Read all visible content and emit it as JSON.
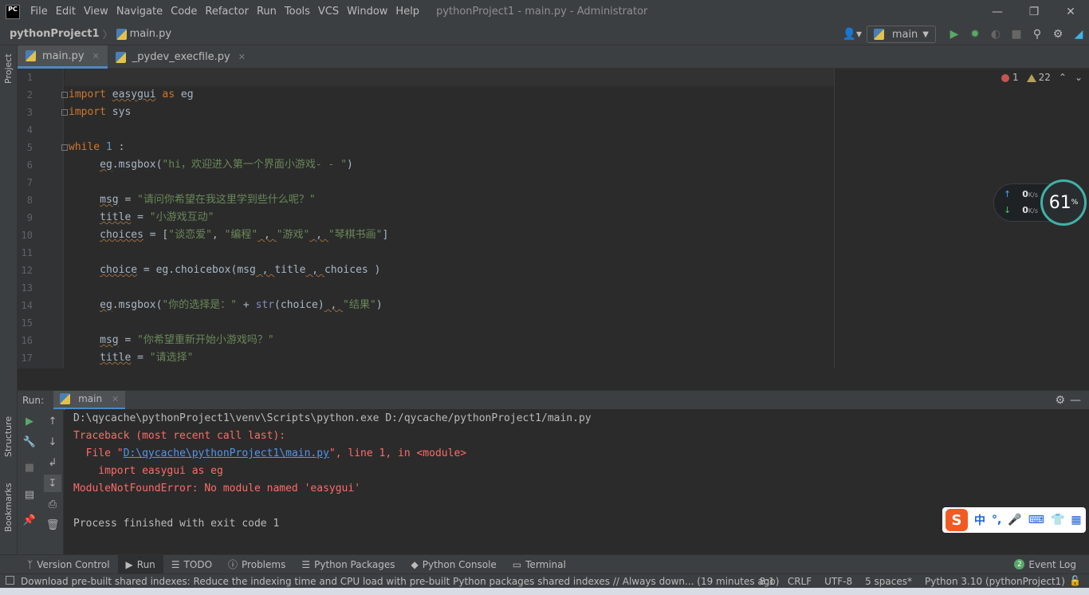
{
  "app": {
    "logo": "PC",
    "window_title": "pythonProject1 - main.py - Administrator",
    "menu": [
      "File",
      "Edit",
      "View",
      "Navigate",
      "Code",
      "Refactor",
      "Run",
      "Tools",
      "VCS",
      "Window",
      "Help"
    ]
  },
  "navbar": {
    "project": "pythonProject1",
    "file": "main.py",
    "run_config": "main"
  },
  "left_strip": {
    "project_label": "Project",
    "structure_label": "Structure",
    "bookmarks_label": "Bookmarks"
  },
  "editor_tabs": [
    {
      "label": "main.py"
    },
    {
      "label": "_pydev_execfile.py"
    }
  ],
  "inspections": {
    "errors": "1",
    "warnings": "22"
  },
  "line_numbers": [
    "1",
    "2",
    "3",
    "4",
    "5",
    "6",
    "7",
    "8",
    "9",
    "10",
    "11",
    "12",
    "13",
    "14",
    "15",
    "16",
    "17"
  ],
  "code": {
    "l2": {
      "kw1": "import",
      "mod": "easygui",
      "kw2": "as",
      "alias": "eg"
    },
    "l3": {
      "kw": "import",
      "mod": "sys"
    },
    "l5": {
      "kw": "while",
      "num": "1",
      "rest": " :"
    },
    "l6": {
      "obj": "eg",
      "call": ".msgbox(",
      "str": "\"hi，欢迎进入第一个界面小游戏- - \"",
      "end": ")"
    },
    "l8": {
      "var": "msg",
      "eq": " = ",
      "str": "\"请问你希望在我这里学到些什么呢？\""
    },
    "l9": {
      "var": "title",
      "eq": " = ",
      "str": "\"小游戏互动\""
    },
    "l10": {
      "var": "choices",
      "eq": " = [",
      "s1": "\"谈恋爱\"",
      "c1": ", ",
      "s2": "\"编程\"",
      "c2": " , ",
      "s3": "\"游戏\"",
      "c3": " , ",
      "s4": "\"琴棋书画\"",
      "end": "]"
    },
    "l12": {
      "var": "choice",
      "eq": " = eg.choicebox(",
      "a1": "msg",
      "c1": " , ",
      "a2": "title",
      "c2": " , ",
      "a3": "choices",
      "end": " )"
    },
    "l14": {
      "obj": "eg",
      "call": ".msgbox(",
      "s1": "\"你的选择是：\"",
      "plus": " + ",
      "builtin": "str",
      "arg": "(choice)",
      "c1": " , ",
      "s2": "\"结果\"",
      "end": ")"
    },
    "l16": {
      "var": "msg",
      "eq": " = ",
      "str": "\"你希望重新开始小游戏吗？\""
    },
    "l17": {
      "var": "title",
      "eq": " = ",
      "str": "\"请选择\""
    }
  },
  "net_widget": {
    "up": "0",
    "down": "0",
    "unit": "K/s",
    "percent": "61",
    "percent_sign": "%"
  },
  "run_panel": {
    "label": "Run:",
    "tab": "main",
    "lines": {
      "cmd": "D:\\qycache\\pythonProject1\\venv\\Scripts\\python.exe D:/qycache/pythonProject1/main.py",
      "traceback": "Traceback (most recent call last):",
      "file_prefix": "  File \"",
      "file_link": "D:\\qycache\\pythonProject1\\main.py",
      "file_suffix": "\", line 1, in <module>",
      "import_line": "    import easygui as eg",
      "error": "ModuleNotFoundError: No module named 'easygui'",
      "finished": "Process finished with exit code 1"
    }
  },
  "ime": {
    "logo": "S",
    "lang": "中",
    "punct": "°,"
  },
  "tool_windows": [
    {
      "label": "Version Control",
      "icon": "branch-icon"
    },
    {
      "label": "Run",
      "icon": "play-icon"
    },
    {
      "label": "TODO",
      "icon": "list-icon"
    },
    {
      "label": "Problems",
      "icon": "info-icon"
    },
    {
      "label": "Python Packages",
      "icon": "layers-icon"
    },
    {
      "label": "Python Console",
      "icon": "python-icon"
    },
    {
      "label": "Terminal",
      "icon": "terminal-icon"
    }
  ],
  "event_log": {
    "count": "2",
    "label": "Event Log"
  },
  "status": {
    "message": "Download pre-built shared indexes: Reduce the indexing time and CPU load with pre-built Python packages shared indexes // Always down... (19 minutes ago)",
    "position": "8:1",
    "line_sep": "CRLF",
    "encoding": "UTF-8",
    "indent": "5 spaces*",
    "interpreter": "Python 3.10 (pythonProject1)"
  },
  "colors": {
    "accent": "#4a88c7",
    "error": "#ff6b68",
    "keyword": "#cc7832",
    "string": "#6a8759"
  }
}
